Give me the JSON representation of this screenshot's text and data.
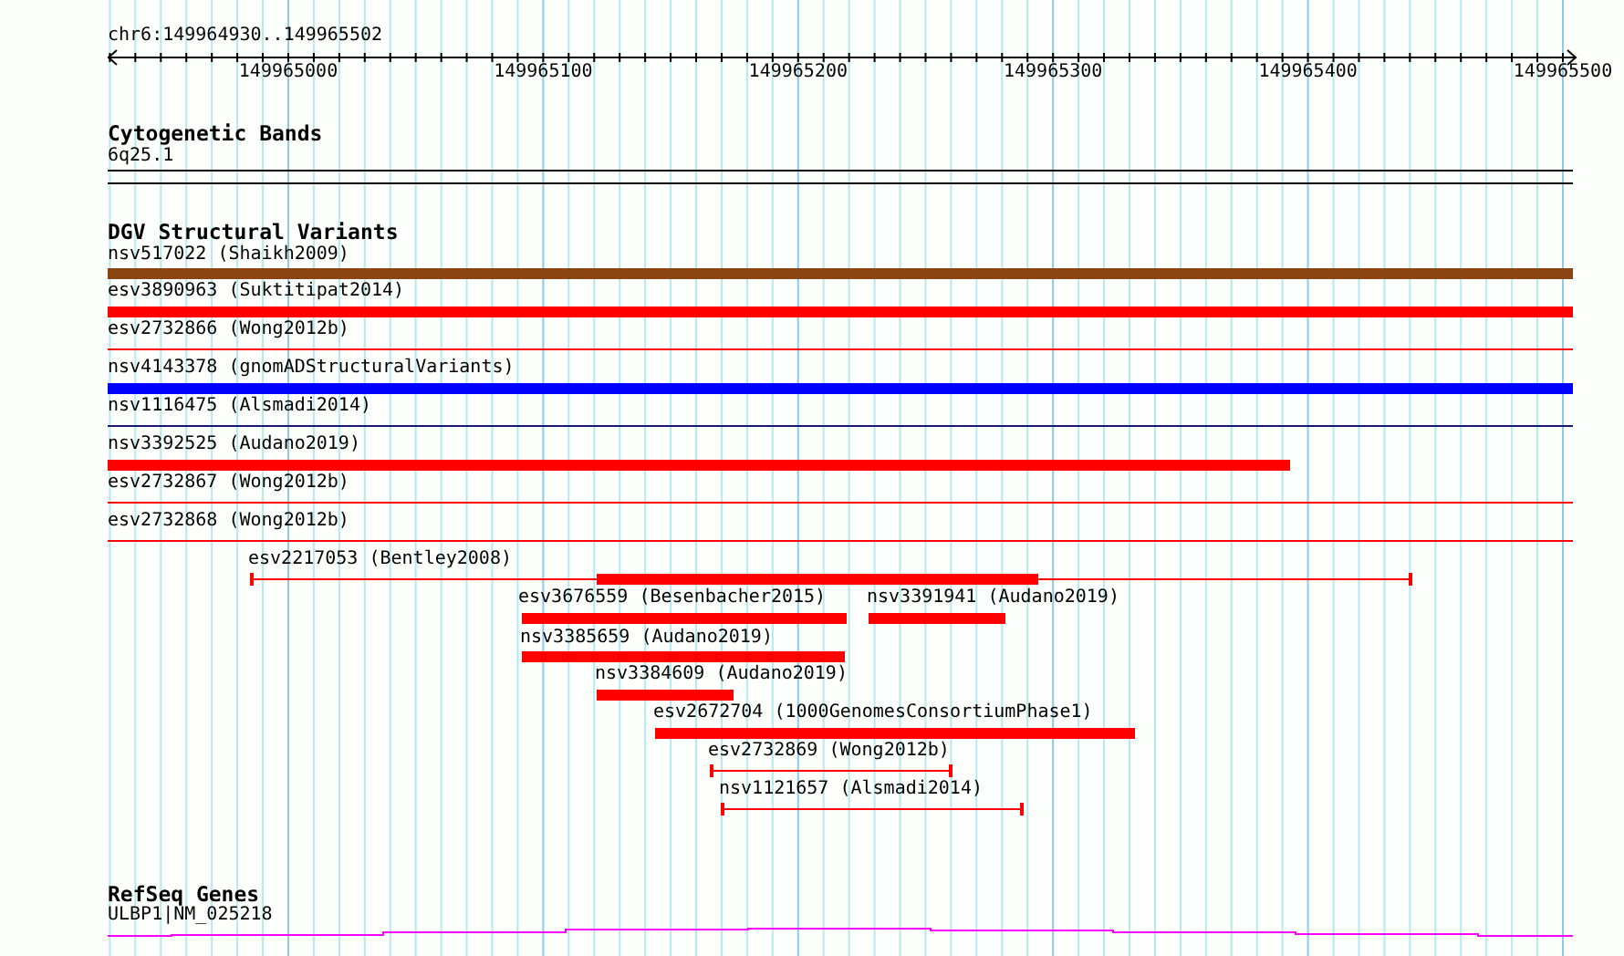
{
  "location": "chr6:149964930..149965502",
  "ruler": {
    "tick_labels": [
      "149965000",
      "149965100",
      "149965200",
      "149965300",
      "149965400",
      "149965500"
    ]
  },
  "tracks": [
    {
      "kind": "cytoband",
      "title": "Cytogenetic Bands",
      "features": [
        {
          "label": "6q25.1"
        }
      ]
    },
    {
      "kind": "variants",
      "title": "DGV Structural Variants",
      "features": [
        {
          "label": "nsv517022 (Shaikh2009)",
          "kind": "bar",
          "color": "#8b4513"
        },
        {
          "label": "esv3890963 (Suktitipat2014)",
          "kind": "bar",
          "color": "#ff0000"
        },
        {
          "label": "esv2732866 (Wong2012b)",
          "kind": "line",
          "color": "#ff0000"
        },
        {
          "label": "nsv4143378 (gnomADStructuralVariants)",
          "kind": "bar",
          "color": "#0000ff"
        },
        {
          "label": "nsv1116475 (Alsmadi2014)",
          "kind": "line",
          "color": "#191970"
        },
        {
          "label": "nsv3392525 (Audano2019)",
          "kind": "bar",
          "color": "#ff0000"
        },
        {
          "label": "esv2732867 (Wong2012b)",
          "kind": "line",
          "color": "#ff0000"
        },
        {
          "label": "esv2732868 (Wong2012b)",
          "kind": "line",
          "color": "#ff0000"
        },
        {
          "label": "esv2217053 (Bentley2008)",
          "kind": "span_bar",
          "color": "#ff0000"
        },
        {
          "label": "esv3676559 (Besenbacher2015)",
          "kind": "bar",
          "color": "#ff0000"
        },
        {
          "label": "nsv3391941 (Audano2019)",
          "kind": "bar",
          "color": "#ff0000"
        },
        {
          "label": "nsv3385659 (Audano2019)",
          "kind": "bar",
          "color": "#ff0000"
        },
        {
          "label": "nsv3384609 (Audano2019)",
          "kind": "bar",
          "color": "#ff0000"
        },
        {
          "label": "esv2672704 (1000GenomesConsortiumPhase1)",
          "kind": "bar",
          "color": "#ff0000"
        },
        {
          "label": "esv2732869 (Wong2012b)",
          "kind": "span",
          "color": "#ff0000"
        },
        {
          "label": "nsv1121657 (Alsmadi2014)",
          "kind": "span",
          "color": "#ff0000"
        }
      ]
    },
    {
      "kind": "genes",
      "title": "RefSeq Genes",
      "features": [
        {
          "label": "ULBP1|NM_025218"
        }
      ]
    }
  ]
}
